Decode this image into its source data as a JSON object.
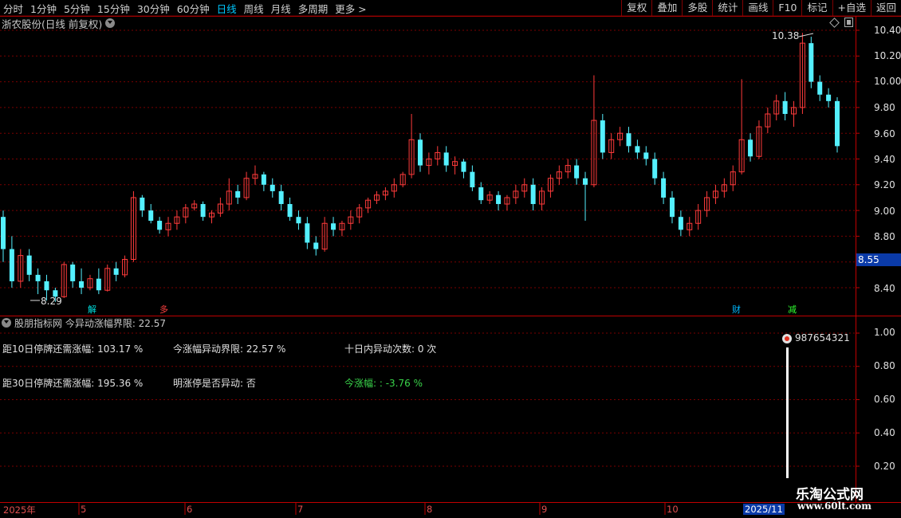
{
  "toolbar": {
    "periods": [
      "分时",
      "1分钟",
      "5分钟",
      "15分钟",
      "30分钟",
      "60分钟",
      "日线",
      "周线",
      "月线",
      "多周期",
      "更多 >"
    ],
    "active_period": "日线",
    "actions": [
      "复权",
      "叠加",
      "多股",
      "统计",
      "画线",
      "F10",
      "标记",
      "+自选",
      "返回"
    ]
  },
  "main_chart": {
    "title": "浙农股份(日线 前复权)",
    "high_label": "10.38",
    "low_label": "8.29",
    "current_price": "8.55",
    "y_ticks": [
      "10.40",
      "10.20",
      "10.00",
      "9.80",
      "9.60",
      "9.40",
      "9.20",
      "9.00",
      "8.80",
      "8.40"
    ],
    "markers": [
      "解",
      "多",
      "财",
      "减"
    ]
  },
  "sub_chart": {
    "title": "股朋指标网 今异动涨幅界限: 22.57",
    "row1": {
      "col1": "距10日停牌还需涨幅: 103.17 %",
      "col2": "今涨幅异动界限: 22.57 %",
      "col3": "十日内异动次数: 0 次"
    },
    "row2": {
      "col1": "距30日停牌还需涨幅: 195.36 %",
      "col2": "明涨停是否异动: 否",
      "col3": "今涨幅: : -3.76 %"
    },
    "value_label": "987654321",
    "y_ticks": [
      "1.00",
      "0.80",
      "0.60",
      "0.40",
      "0.20"
    ]
  },
  "datebar": {
    "labels": [
      "2025年",
      "5",
      "6",
      "7",
      "8",
      "9",
      "10"
    ],
    "active": "2025/11"
  },
  "watermark": {
    "line1": "乐淘公式网",
    "line2": "www.60lt.com"
  },
  "colors": {
    "up": "#ff3b3b",
    "down": "#54f0ff",
    "grid": "#7a0000",
    "active": "#00c8ff",
    "accent_box": "#0a3aa8"
  },
  "chart_data": {
    "type": "candlestick",
    "y_ticks": [
      8.4,
      8.8,
      9.0,
      9.2,
      9.4,
      9.6,
      9.8,
      10.0,
      10.2,
      10.4
    ],
    "high_label_value": 10.38,
    "low_label_value": 8.29,
    "candles": [
      [
        8.95,
        9.0,
        8.6,
        8.7
      ],
      [
        8.7,
        8.8,
        8.4,
        8.45
      ],
      [
        8.45,
        8.7,
        8.4,
        8.65
      ],
      [
        8.65,
        8.7,
        8.45,
        8.5
      ],
      [
        8.5,
        8.55,
        8.35,
        8.45
      ],
      [
        8.45,
        8.5,
        8.3,
        8.38
      ],
      [
        8.38,
        8.4,
        8.29,
        8.33
      ],
      [
        8.33,
        8.6,
        8.32,
        8.58
      ],
      [
        8.58,
        8.6,
        8.4,
        8.45
      ],
      [
        8.45,
        8.55,
        8.35,
        8.4
      ],
      [
        8.4,
        8.5,
        8.38,
        8.47
      ],
      [
        8.47,
        8.55,
        8.35,
        8.38
      ],
      [
        8.38,
        8.58,
        8.37,
        8.55
      ],
      [
        8.55,
        8.6,
        8.45,
        8.5
      ],
      [
        8.5,
        8.65,
        8.48,
        8.62
      ],
      [
        8.62,
        9.15,
        8.6,
        9.1
      ],
      [
        9.1,
        9.12,
        8.95,
        9.0
      ],
      [
        9.0,
        9.05,
        8.9,
        8.92
      ],
      [
        8.92,
        8.95,
        8.82,
        8.85
      ],
      [
        8.85,
        8.95,
        8.8,
        8.9
      ],
      [
        8.9,
        9.0,
        8.85,
        8.95
      ],
      [
        8.95,
        9.05,
        8.9,
        9.02
      ],
      [
        9.02,
        9.08,
        9.0,
        9.05
      ],
      [
        9.05,
        9.07,
        8.92,
        8.95
      ],
      [
        8.95,
        9.0,
        8.9,
        8.98
      ],
      [
        8.98,
        9.1,
        8.95,
        9.05
      ],
      [
        9.05,
        9.25,
        9.0,
        9.15
      ],
      [
        9.15,
        9.2,
        9.05,
        9.1
      ],
      [
        9.1,
        9.3,
        9.08,
        9.25
      ],
      [
        9.25,
        9.35,
        9.2,
        9.28
      ],
      [
        9.28,
        9.3,
        9.15,
        9.2
      ],
      [
        9.2,
        9.25,
        9.1,
        9.15
      ],
      [
        9.15,
        9.2,
        9.0,
        9.05
      ],
      [
        9.05,
        9.1,
        8.92,
        8.95
      ],
      [
        8.95,
        9.0,
        8.85,
        8.9
      ],
      [
        8.9,
        8.95,
        8.7,
        8.75
      ],
      [
        8.75,
        8.8,
        8.65,
        8.7
      ],
      [
        8.7,
        8.95,
        8.68,
        8.9
      ],
      [
        8.9,
        8.95,
        8.8,
        8.85
      ],
      [
        8.85,
        8.92,
        8.8,
        8.9
      ],
      [
        8.9,
        9.0,
        8.85,
        8.95
      ],
      [
        8.95,
        9.05,
        8.9,
        9.02
      ],
      [
        9.02,
        9.1,
        8.98,
        9.08
      ],
      [
        9.08,
        9.15,
        9.05,
        9.12
      ],
      [
        9.12,
        9.18,
        9.08,
        9.15
      ],
      [
        9.15,
        9.25,
        9.1,
        9.2
      ],
      [
        9.2,
        9.3,
        9.18,
        9.28
      ],
      [
        9.28,
        9.75,
        9.25,
        9.55
      ],
      [
        9.55,
        9.6,
        9.3,
        9.35
      ],
      [
        9.35,
        9.45,
        9.28,
        9.4
      ],
      [
        9.4,
        9.5,
        9.35,
        9.45
      ],
      [
        9.45,
        9.5,
        9.3,
        9.35
      ],
      [
        9.35,
        9.42,
        9.28,
        9.38
      ],
      [
        9.38,
        9.4,
        9.25,
        9.3
      ],
      [
        9.3,
        9.35,
        9.15,
        9.18
      ],
      [
        9.18,
        9.22,
        9.05,
        9.08
      ],
      [
        9.08,
        9.15,
        9.05,
        9.12
      ],
      [
        9.12,
        9.15,
        9.0,
        9.05
      ],
      [
        9.05,
        9.12,
        9.0,
        9.1
      ],
      [
        9.1,
        9.2,
        9.05,
        9.15
      ],
      [
        9.15,
        9.25,
        9.1,
        9.2
      ],
      [
        9.2,
        9.25,
        9.0,
        9.05
      ],
      [
        9.05,
        9.18,
        9.0,
        9.15
      ],
      [
        9.15,
        9.28,
        9.1,
        9.25
      ],
      [
        9.25,
        9.35,
        9.2,
        9.3
      ],
      [
        9.3,
        9.4,
        9.25,
        9.35
      ],
      [
        9.35,
        9.4,
        9.2,
        9.25
      ],
      [
        9.25,
        9.3,
        8.92,
        9.2
      ],
      [
        9.2,
        10.05,
        9.18,
        9.7
      ],
      [
        9.7,
        9.75,
        9.4,
        9.45
      ],
      [
        9.45,
        9.6,
        9.4,
        9.55
      ],
      [
        9.55,
        9.65,
        9.5,
        9.6
      ],
      [
        9.6,
        9.65,
        9.45,
        9.5
      ],
      [
        9.5,
        9.55,
        9.4,
        9.45
      ],
      [
        9.45,
        9.5,
        9.35,
        9.4
      ],
      [
        9.4,
        9.45,
        9.2,
        9.25
      ],
      [
        9.25,
        9.3,
        9.05,
        9.1
      ],
      [
        9.1,
        9.15,
        8.9,
        8.95
      ],
      [
        8.95,
        9.0,
        8.8,
        8.85
      ],
      [
        8.85,
        8.95,
        8.8,
        8.9
      ],
      [
        8.9,
        9.05,
        8.85,
        9.0
      ],
      [
        9.0,
        9.15,
        8.95,
        9.1
      ],
      [
        9.1,
        9.2,
        9.05,
        9.15
      ],
      [
        9.15,
        9.25,
        9.1,
        9.2
      ],
      [
        9.2,
        9.35,
        9.15,
        9.3
      ],
      [
        9.3,
        10.02,
        9.28,
        9.55
      ],
      [
        9.55,
        9.6,
        9.38,
        9.42
      ],
      [
        9.42,
        9.7,
        9.4,
        9.65
      ],
      [
        9.65,
        9.8,
        9.6,
        9.75
      ],
      [
        9.75,
        9.9,
        9.7,
        9.85
      ],
      [
        9.85,
        9.92,
        9.7,
        9.75
      ],
      [
        9.75,
        9.85,
        9.65,
        9.8
      ],
      [
        9.8,
        10.38,
        9.75,
        10.3
      ],
      [
        10.3,
        10.35,
        9.95,
        10.0
      ],
      [
        10.0,
        10.05,
        9.85,
        9.9
      ],
      [
        9.9,
        9.95,
        9.8,
        9.85
      ],
      [
        9.85,
        9.88,
        9.45,
        9.5
      ]
    ]
  }
}
